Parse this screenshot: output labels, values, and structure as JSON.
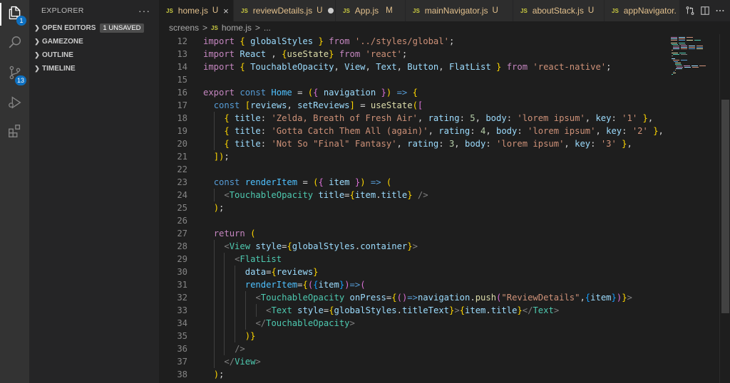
{
  "activity_bar": {
    "explorer_badge": "1",
    "source_control_badge": "13",
    "items": [
      {
        "icon": "files-icon",
        "active": true
      },
      {
        "icon": "search-icon",
        "active": false
      },
      {
        "icon": "source-control-icon",
        "active": false
      },
      {
        "icon": "run-debug-icon",
        "active": false
      },
      {
        "icon": "extensions-icon",
        "active": false
      }
    ]
  },
  "sidebar": {
    "title": "EXPLORER",
    "more": "···",
    "sections": [
      {
        "label": "OPEN EDITORS",
        "badge": "1 UNSAVED"
      },
      {
        "label": "GAMEZONE",
        "badge": ""
      },
      {
        "label": "OUTLINE",
        "badge": ""
      },
      {
        "label": "TIMELINE",
        "badge": ""
      }
    ]
  },
  "tabs": [
    {
      "icon": "JS",
      "name": "home.js",
      "status": "U",
      "active": true,
      "close": "×"
    },
    {
      "icon": "JS",
      "name": "reviewDetails.js",
      "status": "U",
      "active": false,
      "dirty": true
    },
    {
      "icon": "JS",
      "name": "App.js",
      "status": "M",
      "active": false
    },
    {
      "icon": "JS",
      "name": "mainNavigator.js",
      "status": "U",
      "active": false
    },
    {
      "icon": "JS",
      "name": "aboutStack.js",
      "status": "U",
      "active": false
    },
    {
      "icon": "JS",
      "name": "appNavigator.",
      "status": "",
      "active": false
    }
  ],
  "editor_actions": [
    "open-changes-icon",
    "split-editor-icon",
    "more-actions-icon"
  ],
  "breadcrumb": {
    "folder": "screens",
    "sep": ">",
    "file_icon": "JS",
    "file": "home.js",
    "more": "..."
  },
  "code": {
    "line_numbers": [
      "12",
      "13",
      "14",
      "15",
      "16",
      "17",
      "18",
      "19",
      "20",
      "21",
      "22",
      "23",
      "24",
      "25",
      "26",
      "27",
      "28",
      "29",
      "30",
      "31",
      "32",
      "33",
      "34",
      "35",
      "36",
      "37",
      "38"
    ],
    "lines": [
      "import { globalStyles } from '../styles/global';",
      "import React , {useState} from 'react';",
      "import { TouchableOpacity, View, Text, Button, FlatList } from 'react-native';",
      "",
      "export const Home = ({ navigation }) => {",
      "  const [reviews, setReviews] = useState([",
      "    { title: 'Zelda, Breath of Fresh Air', rating: 5, body: 'lorem ipsum', key: '1' },",
      "    { title: 'Gotta Catch Them All (again)', rating: 4, body: 'lorem ipsum', key: '2' },",
      "    { title: 'Not So \"Final\" Fantasy', rating: 3, body: 'lorem ipsum', key: '3' },",
      "  ]);",
      "",
      "  const renderItem = ({ item }) => (",
      "    <TouchableOpacity title={item.title} />",
      "  );",
      "",
      "  return (",
      "    <View style={globalStyles.container}>",
      "      <FlatList",
      "        data={reviews}",
      "        renderItem={({item})=>(",
      "          <TouchableOpacity onPress={()=>navigation.push(\"ReviewDetails\",{item})}>",
      "            <Text style={globalStyles.titleText}>{item.title}</Text>",
      "          </TouchableOpacity>",
      "        )}",
      "      />",
      "    </View>",
      "  );"
    ]
  },
  "colors": {
    "background": "#1e1e1e",
    "sidebar": "#252526",
    "activity_bar": "#333333",
    "keyword": "#c586c0",
    "storage": "#569cd6",
    "string": "#ce9178",
    "variable": "#9cdcfe",
    "function": "#dcdcaa",
    "number": "#b5cea8",
    "component": "#4ec9b0",
    "git_untracked": "#e2c08d"
  }
}
